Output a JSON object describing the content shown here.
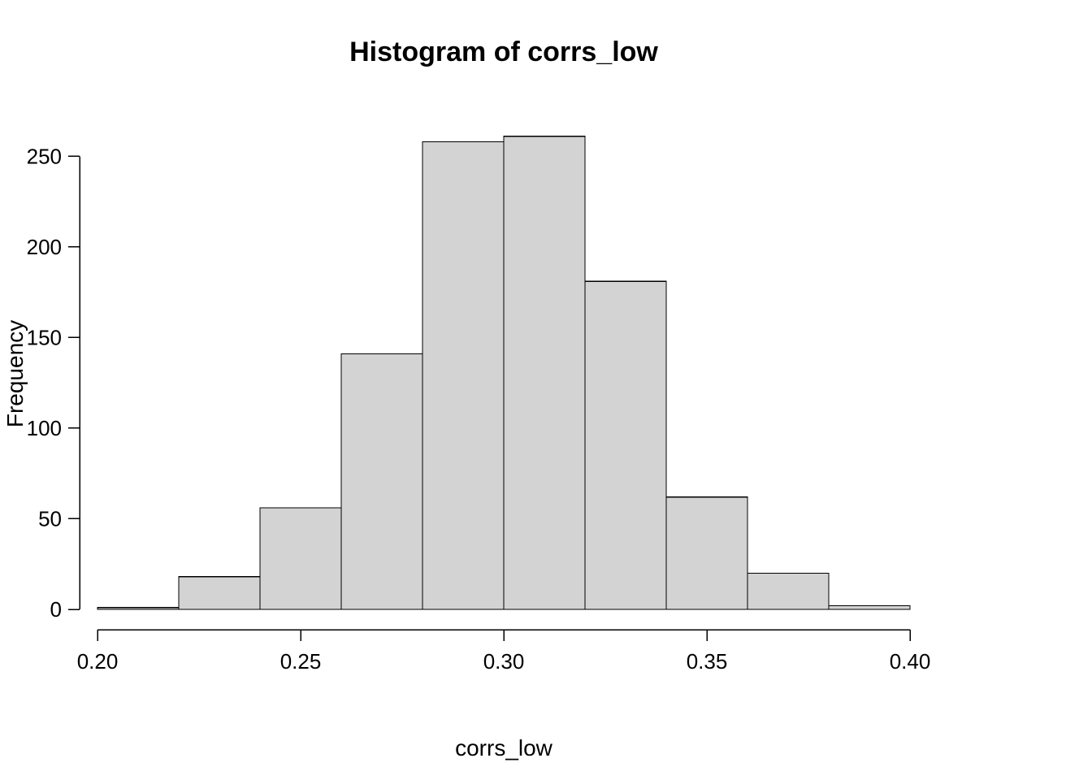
{
  "chart_data": {
    "type": "bar",
    "title": "Histogram of corrs_low",
    "xlabel": "corrs_low",
    "ylabel": "Frequency",
    "xlim": [
      0.2,
      0.4
    ],
    "ylim": [
      0,
      260
    ],
    "x_ticks": [
      0.2,
      0.25,
      0.3,
      0.35,
      0.4
    ],
    "y_ticks": [
      0,
      50,
      100,
      150,
      200,
      250
    ],
    "bin_width": 0.02,
    "bins": [
      {
        "x0": 0.2,
        "x1": 0.22,
        "count": 1
      },
      {
        "x0": 0.22,
        "x1": 0.24,
        "count": 18
      },
      {
        "x0": 0.24,
        "x1": 0.26,
        "count": 56
      },
      {
        "x0": 0.26,
        "x1": 0.28,
        "count": 141
      },
      {
        "x0": 0.28,
        "x1": 0.3,
        "count": 258
      },
      {
        "x0": 0.3,
        "x1": 0.32,
        "count": 261
      },
      {
        "x0": 0.32,
        "x1": 0.34,
        "count": 181
      },
      {
        "x0": 0.34,
        "x1": 0.36,
        "count": 62
      },
      {
        "x0": 0.36,
        "x1": 0.38,
        "count": 20
      },
      {
        "x0": 0.38,
        "x1": 0.4,
        "count": 2
      }
    ],
    "colors": {
      "bar_fill": "#d3d3d3",
      "bar_stroke": "#000000",
      "bg": "#ffffff"
    }
  },
  "labels": {
    "title": "Histogram of corrs_low",
    "xlabel": "corrs_low",
    "ylabel": "Frequency",
    "xt_0": "0.20",
    "xt_1": "0.25",
    "xt_2": "0.30",
    "xt_3": "0.35",
    "xt_4": "0.40",
    "yt_0": "0",
    "yt_1": "50",
    "yt_2": "100",
    "yt_3": "150",
    "yt_4": "200",
    "yt_5": "250"
  }
}
